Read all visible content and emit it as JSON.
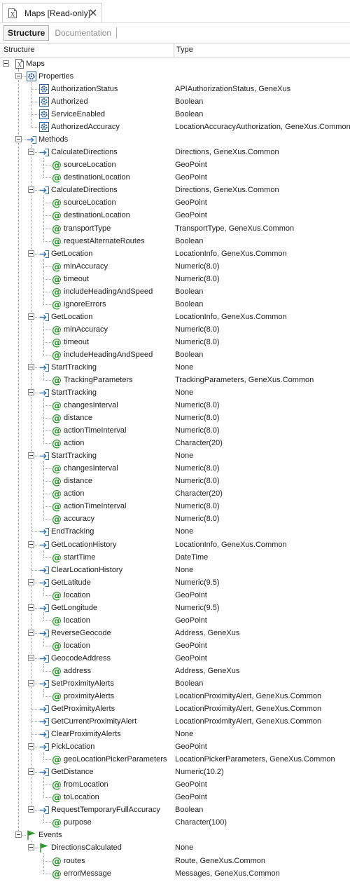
{
  "document_tab": {
    "title": "Maps [Read-only]"
  },
  "sub_tabs": [
    {
      "label": "Structure",
      "active": true
    },
    {
      "label": "Documentation",
      "active": false
    }
  ],
  "columns": {
    "structure": "Structure",
    "type": "Type"
  },
  "colors": {
    "method_arrow": "#2f6fb5",
    "property_gear": "#2f5f9a",
    "param_at": "#2a9a2a",
    "event_flag": "#2a9a2a"
  },
  "tree": [
    {
      "kind": "root",
      "label": "Maps",
      "type": ""
    },
    {
      "kind": "folder-properties",
      "label": "Properties",
      "type": ""
    },
    {
      "kind": "property",
      "label": "AuthorizationStatus",
      "type": "APIAuthorizationStatus, GeneXus"
    },
    {
      "kind": "property",
      "label": "Authorized",
      "type": "Boolean"
    },
    {
      "kind": "property",
      "label": "ServiceEnabled",
      "type": "Boolean"
    },
    {
      "kind": "property",
      "label": "AuthorizedAccuracy",
      "type": "LocationAccuracyAuthorization, GeneXus.Common"
    },
    {
      "kind": "folder-methods",
      "label": "Methods",
      "type": ""
    },
    {
      "kind": "method",
      "label": "CalculateDirections",
      "type": "Directions, GeneXus.Common"
    },
    {
      "kind": "param",
      "label": "sourceLocation",
      "type": "GeoPoint"
    },
    {
      "kind": "param",
      "label": "destinationLocation",
      "type": "GeoPoint"
    },
    {
      "kind": "method",
      "label": "CalculateDirections",
      "type": "Directions, GeneXus.Common"
    },
    {
      "kind": "param",
      "label": "sourceLocation",
      "type": "GeoPoint"
    },
    {
      "kind": "param",
      "label": "destinationLocation",
      "type": "GeoPoint"
    },
    {
      "kind": "param",
      "label": "transportType",
      "type": "TransportType, GeneXus.Common"
    },
    {
      "kind": "param",
      "label": "requestAlternateRoutes",
      "type": "Boolean"
    },
    {
      "kind": "method",
      "label": "GetLocation",
      "type": "LocationInfo, GeneXus.Common"
    },
    {
      "kind": "param",
      "label": "minAccuracy",
      "type": "Numeric(8.0)"
    },
    {
      "kind": "param",
      "label": "timeout",
      "type": "Numeric(8.0)"
    },
    {
      "kind": "param",
      "label": "includeHeadingAndSpeed",
      "type": "Boolean"
    },
    {
      "kind": "param",
      "label": "ignoreErrors",
      "type": "Boolean"
    },
    {
      "kind": "method",
      "label": "GetLocation",
      "type": "LocationInfo, GeneXus.Common"
    },
    {
      "kind": "param",
      "label": "minAccuracy",
      "type": "Numeric(8.0)"
    },
    {
      "kind": "param",
      "label": "timeout",
      "type": "Numeric(8.0)"
    },
    {
      "kind": "param",
      "label": "includeHeadingAndSpeed",
      "type": "Boolean"
    },
    {
      "kind": "method",
      "label": "StartTracking",
      "type": "None"
    },
    {
      "kind": "param",
      "label": "TrackingParameters",
      "type": "TrackingParameters, GeneXus.Common"
    },
    {
      "kind": "method",
      "label": "StartTracking",
      "type": "None"
    },
    {
      "kind": "param",
      "label": "changesInterval",
      "type": "Numeric(8.0)"
    },
    {
      "kind": "param",
      "label": "distance",
      "type": "Numeric(8.0)"
    },
    {
      "kind": "param",
      "label": "actionTimeInterval",
      "type": "Numeric(8.0)"
    },
    {
      "kind": "param",
      "label": "action",
      "type": "Character(20)"
    },
    {
      "kind": "method",
      "label": "StartTracking",
      "type": "None"
    },
    {
      "kind": "param",
      "label": "changesInterval",
      "type": "Numeric(8.0)"
    },
    {
      "kind": "param",
      "label": "distance",
      "type": "Numeric(8.0)"
    },
    {
      "kind": "param",
      "label": "action",
      "type": "Character(20)"
    },
    {
      "kind": "param",
      "label": "actionTimeInterval",
      "type": "Numeric(8.0)"
    },
    {
      "kind": "param",
      "label": "accuracy",
      "type": "Numeric(8.0)"
    },
    {
      "kind": "method",
      "label": "EndTracking",
      "type": "None"
    },
    {
      "kind": "method",
      "label": "GetLocationHistory",
      "type": "LocationInfo, GeneXus.Common"
    },
    {
      "kind": "param",
      "label": "startTime",
      "type": "DateTime"
    },
    {
      "kind": "method",
      "label": "ClearLocationHistory",
      "type": "None"
    },
    {
      "kind": "method",
      "label": "GetLatitude",
      "type": "Numeric(9.5)"
    },
    {
      "kind": "param",
      "label": "location",
      "type": "GeoPoint"
    },
    {
      "kind": "method",
      "label": "GetLongitude",
      "type": "Numeric(9.5)"
    },
    {
      "kind": "param",
      "label": "location",
      "type": "GeoPoint"
    },
    {
      "kind": "method",
      "label": "ReverseGeocode",
      "type": "Address, GeneXus"
    },
    {
      "kind": "param",
      "label": "location",
      "type": "GeoPoint"
    },
    {
      "kind": "method",
      "label": "GeocodeAddress",
      "type": "GeoPoint"
    },
    {
      "kind": "param",
      "label": "address",
      "type": "Address, GeneXus"
    },
    {
      "kind": "method",
      "label": "SetProximityAlerts",
      "type": "Boolean"
    },
    {
      "kind": "param",
      "label": "proximityAlerts",
      "type": "LocationProximityAlert, GeneXus.Common"
    },
    {
      "kind": "method",
      "label": "GetProximityAlerts",
      "type": "LocationProximityAlert, GeneXus.Common"
    },
    {
      "kind": "method",
      "label": "GetCurrentProximityAlert",
      "type": "LocationProximityAlert, GeneXus.Common"
    },
    {
      "kind": "method",
      "label": "ClearProximityAlerts",
      "type": "None"
    },
    {
      "kind": "method",
      "label": "PickLocation",
      "type": "GeoPoint"
    },
    {
      "kind": "param",
      "label": "geoLocationPickerParameters",
      "type": "LocationPickerParameters, GeneXus.Common"
    },
    {
      "kind": "method",
      "label": "GetDistance",
      "type": "Numeric(10.2)"
    },
    {
      "kind": "param",
      "label": "fromLocation",
      "type": "GeoPoint"
    },
    {
      "kind": "param",
      "label": "toLocation",
      "type": "GeoPoint"
    },
    {
      "kind": "method",
      "label": "RequestTemporaryFullAccuracy",
      "type": "Boolean"
    },
    {
      "kind": "param",
      "label": "purpose",
      "type": "Character(100)"
    },
    {
      "kind": "folder-events",
      "label": "Events",
      "type": ""
    },
    {
      "kind": "event",
      "label": "DirectionsCalculated",
      "type": "None"
    },
    {
      "kind": "param-event",
      "label": "routes",
      "type": "Route, GeneXus.Common"
    },
    {
      "kind": "param-event",
      "label": "errorMessage",
      "type": "Messages, GeneXus.Common"
    }
  ]
}
